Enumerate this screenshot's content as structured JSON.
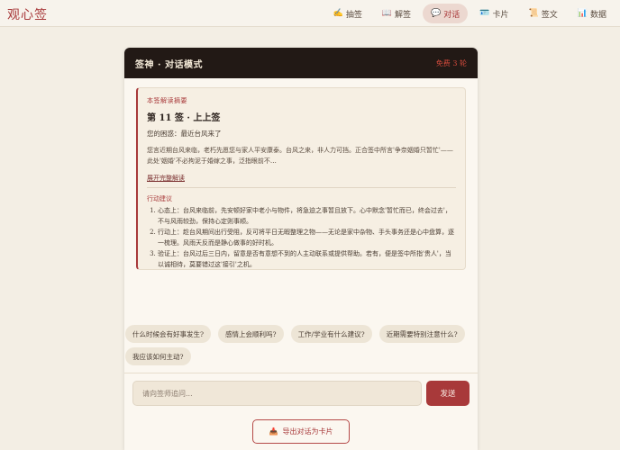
{
  "app": {
    "logo": "观心签"
  },
  "nav": [
    {
      "icon": "✍",
      "label": "抽签",
      "active": false
    },
    {
      "icon": "📖",
      "label": "解签",
      "active": false
    },
    {
      "icon": "💬",
      "label": "对话",
      "active": true
    },
    {
      "icon": "🪪",
      "label": "卡片",
      "active": false
    },
    {
      "icon": "📜",
      "label": "签文",
      "active": false
    },
    {
      "icon": "📊",
      "label": "数据",
      "active": false
    }
  ],
  "panel": {
    "title": "签神 · 对话模式",
    "free": "免费 3 轮"
  },
  "card": {
    "caption": "本签解读摘要",
    "title": "第 11 签 · 上上签",
    "question": "您的困惑：最近台风来了",
    "summary": "您言近期台风来临，老朽先愿您与家人平安康泰。台风之来，非人力可挡。正合签中所言'争奈姻婚只暂忙'——此处'姻婚'不必拘泥于婚嫁之事，泛指眼前不…",
    "expand": "展开完整解读",
    "action_caption": "行动建议",
    "actions": [
      "心态上：台风来临前，先安顿好家中老小与物件，将急迫之事暂且放下。心中默念'暂忙而已，终会过去'，不与风雨较劲，保持心定则事顺。",
      "行动上：趁台风期间出行受阻，反可将平日无暇整理之物——无论是家中杂物、手头事务还是心中盘算，逐一梳理。风雨天反而是静心做事的好时机。",
      "验证上：台风过后三日内，留意是否有意想不到的人主动联系或提供帮助。若有，便是签中所指'贵人'，当以诚相待，莫要错过这'接引'之机。"
    ]
  },
  "chips": [
    "什么时候会有好事发生?",
    "感情上会顺利吗?",
    "工作/学业有什么建议?",
    "近期需要特别注意什么?",
    "我应该如何主动?"
  ],
  "input": {
    "placeholder": "请向签师追问..."
  },
  "send_label": "发送",
  "export": {
    "icon": "📥",
    "label": "导出对话为卡片"
  }
}
